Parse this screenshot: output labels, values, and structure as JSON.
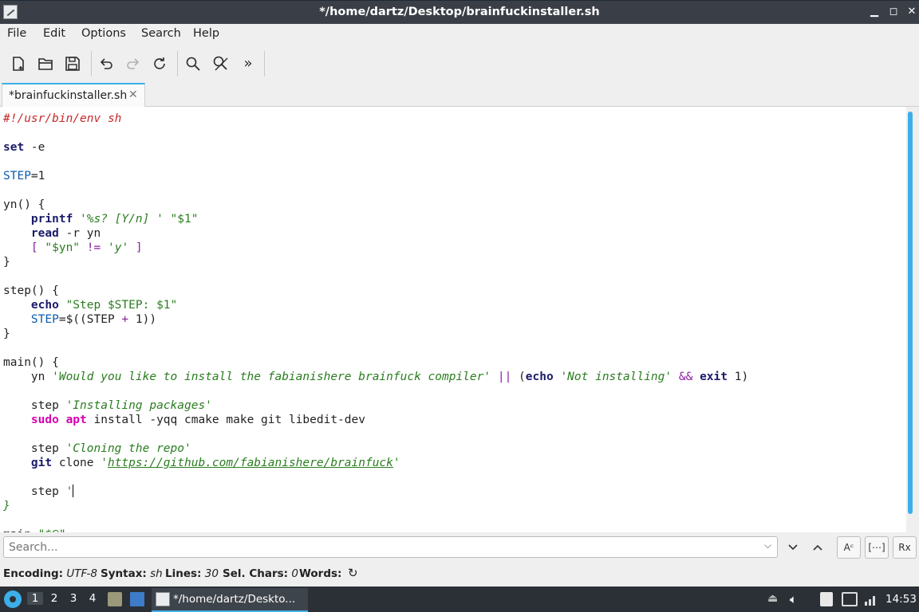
{
  "window": {
    "title": "*/home/dartz/Desktop/brainfuckinstaller.sh",
    "controls": [
      "minimize-icon",
      "maximize-icon",
      "close-icon"
    ]
  },
  "menubar": {
    "items": [
      "File",
      "Edit",
      "Options",
      "Search",
      "Help"
    ]
  },
  "toolbar": {
    "buttons": [
      "new-file",
      "open-file",
      "save",
      "undo",
      "redo",
      "reload",
      "find",
      "find-replace",
      "more"
    ]
  },
  "tabs": [
    {
      "label": "*brainfuckinstaller.sh",
      "close": "✕"
    }
  ],
  "editor": {
    "lines": [
      "#!/usr/bin/env sh",
      "",
      "set -e",
      "",
      "STEP=1",
      "",
      "yn() {",
      "    printf '%s? [Y/n] ' \"$1\"",
      "    read -r yn",
      "    [ \"$yn\" != 'y' ]",
      "}",
      "",
      "step() {",
      "    echo \"Step $STEP: $1\"",
      "    STEP=$((STEP + 1))",
      "}",
      "",
      "main() {",
      "    yn 'Would you like to install the fabianishere brainfuck compiler' || (echo 'Not installing' && exit 1)",
      "",
      "    step 'Installing packages'",
      "    sudo apt install -yqq cmake make git libedit-dev",
      "",
      "    step 'Cloning the repo'",
      "    git clone 'https://github.com/fabianishere/brainfuck'",
      "",
      "    step '",
      "}",
      "",
      "main \"$@\""
    ],
    "t": {
      "shebang": "#!/usr/bin/env sh",
      "set": "set",
      "set_arg": " -e",
      "step_var": "STEP",
      "eq1": "=1",
      "yn_def": "yn() {",
      "printf": "printf",
      "printf_fmt": "'%s? [Y/n] '",
      "dq1": "\"$1\"",
      "read": "read",
      "read_args": " -r yn",
      "br_open": "[",
      "yn_var": "\"$yn\"",
      "neq": "!=",
      "y_str": "'y'",
      "br_close": "]",
      "brace_close": "}",
      "step_def": "step() {",
      "echo": "echo",
      "echo_str": "\"Step $STEP: $1\"",
      "step_inc_pre": "=$((STEP ",
      "plus": "+",
      "step_inc_post": " 1))",
      "main_def": "main() {",
      "yn_call": "yn",
      "q_str": "'Would you like to install the fabianishere brainfuck compiler'",
      "or_op": "||",
      "paren_open": "(",
      "not_inst": "'Not installing'",
      "and_op": "&&",
      "exit": "exit",
      "exit_tail": " 1)",
      "step_call": "step",
      "inst_pkg": "'Installing packages'",
      "sudo": "sudo",
      "apt": "apt",
      "apt_args": " install -yqq cmake make git libedit-dev",
      "clone_msg": "'Cloning the repo'",
      "git": "git",
      "clone": " clone ",
      "url": "https://github.com/fabianishere/brainfuck",
      "quote": "'",
      "main_call": "main",
      "all_args": "\"$@\""
    }
  },
  "search": {
    "placeholder": "Search...",
    "buttons": [
      "chevron-down-icon",
      "chevron-up-icon",
      "match-case",
      "whole-word",
      "regex"
    ],
    "labels": {
      "match_case": "Aᶜ",
      "whole_word": "[⋯]",
      "regex": "Rx"
    }
  },
  "statusbar": {
    "encoding_label": "Encoding:",
    "encoding_value": "UTF-8",
    "syntax_label": "Syntax:",
    "syntax_value": "sh",
    "lines_label": "Lines:",
    "lines_value": "30",
    "selchars_label": "Sel. Chars:",
    "selchars_value": "0",
    "words_label": "Words:"
  },
  "taskbar": {
    "workspaces": [
      "1",
      "2",
      "3",
      "4"
    ],
    "active_workspace": "1",
    "task_label": "*/home/dartz/Deskto...",
    "clock": "14:53"
  },
  "colors": {
    "accent": "#3daee9",
    "comment": "#c62828",
    "keyword": "#1b1b6a",
    "variable": "#0b5cad",
    "string": "#2a7d1f",
    "operator": "#8a1ea3",
    "sudo": "#d400b0"
  }
}
